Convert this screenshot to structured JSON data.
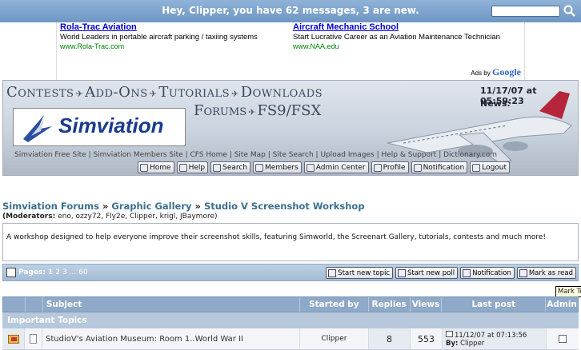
{
  "topbar": {
    "message": "Hey, Clipper, you have 62 messages, 3 are new.",
    "search_placeholder": ""
  },
  "ads": {
    "items": [
      {
        "title": "Rola-Trac Aviation",
        "desc": "World Leaders in portable aircraft parking / taxiing systems",
        "url": "www.Rola-Trac.com"
      },
      {
        "title": "Aircraft Mechanic School",
        "desc": "Start Lucrative Career as an Aviation Maintenance Technician",
        "url": "www.NAA.edu"
      }
    ],
    "ads_by": "Ads by",
    "ads_brand": "Google"
  },
  "banner": {
    "nav_top": [
      "Contests",
      "Add-Ons",
      "Tutorials",
      "Downloads"
    ],
    "nav_mid": [
      "Forums",
      "FS9/FSX"
    ],
    "date": "11/17/07 at 05:59:23",
    "news": "News:",
    "logo": "Simviation",
    "links": [
      "Simviation Free Site",
      "Simviation Members Site",
      "CFS Home",
      "Site Map",
      "Site Search",
      "Upload Images",
      "Help & Support",
      "Dictionary.com"
    ],
    "buttons": [
      "Home",
      "Help",
      "Search",
      "Members",
      "Admin Center",
      "Profile",
      "Notification",
      "Logout"
    ]
  },
  "breadcrumb": {
    "a": "Simviation Forums",
    "b": "Graphic Gallery",
    "c": "Studio V Screenshot Workshop",
    "sep": "»"
  },
  "moderators": {
    "label": "(Moderators:",
    "names": "eno, ozzy72, Fly2e, Clipper, krigl, JBaymore)"
  },
  "description": "A workshop designed to help everyone improve their screenshot skills, featuring Simworld, the Screenart Gallery, tutorials, contests and much more!",
  "pagination": {
    "label": "Pages:",
    "current": "1",
    "others": [
      "2",
      "3"
    ],
    "ellipsis": "...",
    "last": "60"
  },
  "actions": [
    "Start new topic",
    "Start new poll",
    "Notification",
    "Mark as read"
  ],
  "tooltip": "Mark To",
  "table": {
    "headers": {
      "subject": "Subject",
      "started_by": "Started by",
      "replies": "Replies",
      "views": "Views",
      "last_post": "Last post",
      "admin": "Admin"
    },
    "section": "Important Topics",
    "rows": [
      {
        "subject": "StudioV's Aviation Museum: Room 1..World War II",
        "started_by": "Clipper",
        "replies": "8",
        "views": "553",
        "last_date": "11/12/07 at 07:13:56",
        "last_by_label": "By:",
        "last_by": "Clipper"
      }
    ]
  }
}
